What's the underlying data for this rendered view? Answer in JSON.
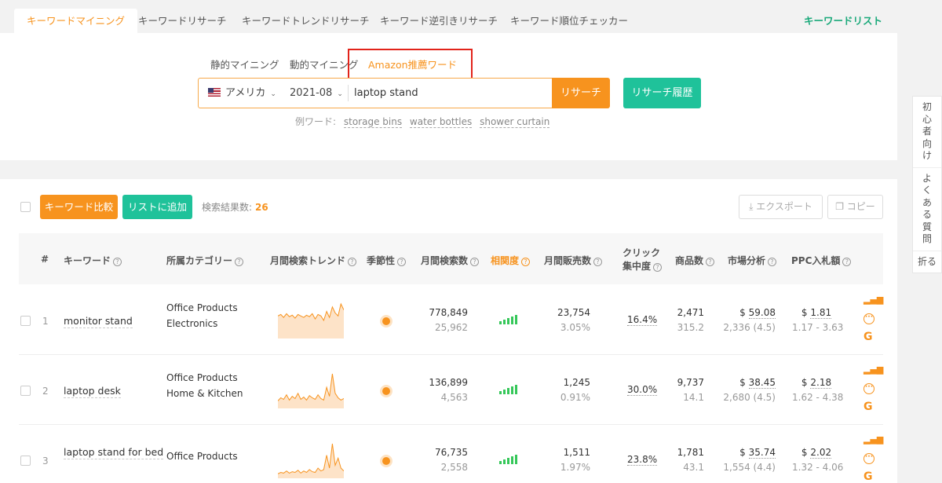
{
  "tabs": [
    {
      "label": "キーワードマイニング",
      "active": true
    },
    {
      "label": "キーワードリサーチ"
    },
    {
      "label": "キーワードトレンドリサーチ"
    },
    {
      "label": "キーワード逆引きリサーチ"
    },
    {
      "label": "キーワード順位チェッカー"
    }
  ],
  "keyword_list_label": "キーワードリスト",
  "subtabs": [
    {
      "label": "静的マイニング"
    },
    {
      "label": "動的マイニング"
    },
    {
      "label": "Amazon推薦ワード",
      "active": true
    }
  ],
  "search": {
    "country": "アメリカ",
    "month": "2021-08",
    "value": "laptop stand",
    "research_label": "リサーチ",
    "history_label": "リサーチ履歴",
    "examples_prefix": "例ワード:",
    "examples": [
      "storage bins",
      "water bottles",
      "shower curtain"
    ]
  },
  "toolbar": {
    "compare_label": "キーワード比較",
    "addlist_label": "リストに追加",
    "count_label": "検索結果数:",
    "count_value": "26",
    "export_label": "エクスポート",
    "copy_label": "コピー"
  },
  "columns": {
    "index": "#",
    "keyword": "キーワード",
    "category": "所属カテゴリー",
    "trend": "月間検索トレンド",
    "seasonality": "季節性",
    "searches": "月間検索数",
    "relevance": "相関度",
    "sales": "月間販売数",
    "click_line1": "クリック",
    "click_line2": "集中度",
    "products": "商品数",
    "market": "市場分析",
    "ppc": "PPC入札額"
  },
  "rows": [
    {
      "index": "1",
      "keyword": "monitor stand",
      "categories": [
        "Office Products",
        "Electronics"
      ],
      "searches": "778,849",
      "searches_sub": "25,962",
      "sales": "23,754",
      "sales_sub": "3.05%",
      "click": "16.4%",
      "products": "2,471",
      "products_sub": "315.2",
      "market_price": "59.08",
      "market_sub": "2,336 (4.5)",
      "ppc": "1.81",
      "ppc_range": "1.17 - 3.63",
      "trend": [
        28,
        30,
        26,
        31,
        27,
        29,
        25,
        30,
        28,
        26,
        29,
        27,
        31,
        24,
        30,
        28,
        22,
        34,
        26,
        40,
        32,
        28,
        44,
        36
      ]
    },
    {
      "index": "2",
      "keyword": "laptop desk",
      "categories": [
        "Office Products",
        "Home & Kitchen"
      ],
      "searches": "136,899",
      "searches_sub": "4,563",
      "sales": "1,245",
      "sales_sub": "0.91%",
      "click": "30.0%",
      "products": "9,737",
      "products_sub": "14.1",
      "market_price": "38.45",
      "market_sub": "2,680 (4.5)",
      "ppc": "2.18",
      "ppc_range": "1.62 - 4.38",
      "trend": [
        8,
        12,
        10,
        16,
        9,
        14,
        11,
        18,
        10,
        13,
        9,
        15,
        12,
        10,
        16,
        11,
        9,
        26,
        14,
        44,
        18,
        12,
        9,
        11
      ]
    },
    {
      "index": "3",
      "keyword": "laptop stand for bed",
      "categories": [
        "Office Products"
      ],
      "searches": "76,735",
      "searches_sub": "2,558",
      "sales": "1,511",
      "sales_sub": "1.97%",
      "click": "23.8%",
      "products": "1,781",
      "products_sub": "43.1",
      "market_price": "35.74",
      "market_sub": "1,554 (4.4)",
      "ppc": "2.02",
      "ppc_range": "1.32 - 4.06",
      "trend": [
        4,
        6,
        5,
        8,
        5,
        7,
        6,
        9,
        5,
        8,
        6,
        10,
        7,
        6,
        12,
        8,
        10,
        30,
        12,
        46,
        16,
        26,
        12,
        8
      ]
    }
  ],
  "currency_symbol": "$",
  "side": {
    "beginner": [
      "初",
      "心",
      "者",
      "向",
      "け"
    ],
    "faq": [
      "よ",
      "く",
      "あ",
      "る",
      "質",
      "問"
    ],
    "fold": "折る"
  },
  "colors": {
    "accent": "#f7931e",
    "green": "#1fc29a",
    "highlight": "#e2231a"
  }
}
